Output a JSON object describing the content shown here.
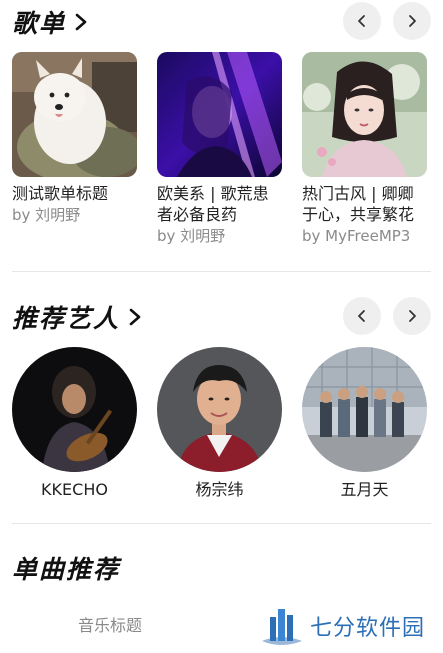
{
  "playlists": {
    "title": "歌单",
    "items": [
      {
        "title": "测试歌单标题",
        "author": "by 刘明野"
      },
      {
        "title": "欧美系 | 歌荒患者必备良药",
        "author": "by 刘明野"
      },
      {
        "title": "热门古风 | 卿卿于心，共享繁花",
        "author": "by MyFreeMP3"
      }
    ]
  },
  "artists": {
    "title": "推荐艺人",
    "items": [
      {
        "name": "KKECHO"
      },
      {
        "name": "杨宗纬"
      },
      {
        "name": "五月天"
      }
    ]
  },
  "songs": {
    "title": "单曲推荐",
    "tab_label": "音乐标题"
  },
  "watermark": {
    "text": "七分软件园"
  },
  "colors": {
    "nav_button_bg": "#efefef",
    "secondary_text": "#8a8a8a",
    "watermark_blue": "#2d6fb6"
  }
}
